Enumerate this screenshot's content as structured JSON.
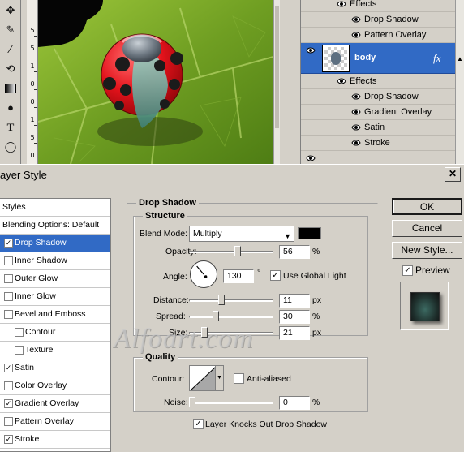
{
  "layers_panel": {
    "rows": [
      {
        "label": "Effects",
        "indent": "effects"
      },
      {
        "label": "Drop Shadow",
        "indent": "item"
      },
      {
        "label": "Pattern Overlay",
        "indent": "item"
      },
      {
        "label": "body",
        "indent": "layer",
        "selected": true,
        "fx": "fx"
      },
      {
        "label": "Effects",
        "indent": "effects"
      },
      {
        "label": "Drop Shadow",
        "indent": "item"
      },
      {
        "label": "Gradient Overlay",
        "indent": "item"
      },
      {
        "label": "Satin",
        "indent": "item"
      },
      {
        "label": "Stroke",
        "indent": "item"
      }
    ]
  },
  "ruler": {
    "numbers": [
      "5",
      "5",
      "1",
      "0",
      "0",
      "1",
      "5",
      "0"
    ]
  },
  "dialog": {
    "title": "ayer Style",
    "watermark": "Alfoart.com",
    "styles": [
      {
        "label": "Styles",
        "checkbox": false,
        "header": true
      },
      {
        "label": "Blending Options: Default",
        "checkbox": false,
        "header": true
      },
      {
        "label": "Drop Shadow",
        "checkbox": true,
        "checked": true,
        "selected": true
      },
      {
        "label": "Inner Shadow",
        "checkbox": true,
        "checked": false
      },
      {
        "label": "Outer Glow",
        "checkbox": true,
        "checked": false
      },
      {
        "label": "Inner Glow",
        "checkbox": true,
        "checked": false
      },
      {
        "label": "Bevel and Emboss",
        "checkbox": true,
        "checked": false
      },
      {
        "label": "Contour",
        "checkbox": true,
        "checked": false,
        "sub": true
      },
      {
        "label": "Texture",
        "checkbox": true,
        "checked": false,
        "sub": true
      },
      {
        "label": "Satin",
        "checkbox": true,
        "checked": true
      },
      {
        "label": "Color Overlay",
        "checkbox": true,
        "checked": false
      },
      {
        "label": "Gradient Overlay",
        "checkbox": true,
        "checked": true
      },
      {
        "label": "Pattern Overlay",
        "checkbox": true,
        "checked": false
      },
      {
        "label": "Stroke",
        "checkbox": true,
        "checked": true
      }
    ],
    "section_title": "Drop Shadow",
    "structure": {
      "title": "Structure",
      "blend_mode_label": "Blend Mode:",
      "blend_mode_value": "Multiply",
      "shadow_color": "#000000",
      "opacity_label": "Opacity:",
      "opacity_value": "56",
      "opacity_unit": "%",
      "opacity_level": 0.56,
      "angle_label": "Angle:",
      "angle_value": "130",
      "angle_unit": "°",
      "use_global_light_label": "Use Global Light",
      "use_global_light_checked": true,
      "distance_label": "Distance:",
      "distance_value": "11",
      "distance_unit": "px",
      "spread_label": "Spread:",
      "spread_value": "30",
      "spread_unit": "%",
      "size_label": "Size:",
      "size_value": "21",
      "size_unit": "px"
    },
    "quality": {
      "title": "Quality",
      "contour_label": "Contour:",
      "anti_aliased_label": "Anti-aliased",
      "anti_aliased_checked": false,
      "noise_label": "Noise:",
      "noise_value": "0",
      "noise_unit": "%"
    },
    "knockout_label": "Layer Knocks Out Drop Shadow",
    "knockout_checked": true,
    "buttons": {
      "ok": "OK",
      "cancel": "Cancel",
      "new_style": "New Style...",
      "preview": "Preview"
    },
    "preview_checked": true
  },
  "colors": {
    "selection_blue": "#316ac5",
    "dialog_gray": "#d4d0c8",
    "ladybug_red": "#e0141c",
    "leaf_green": "#6a9a1c"
  }
}
